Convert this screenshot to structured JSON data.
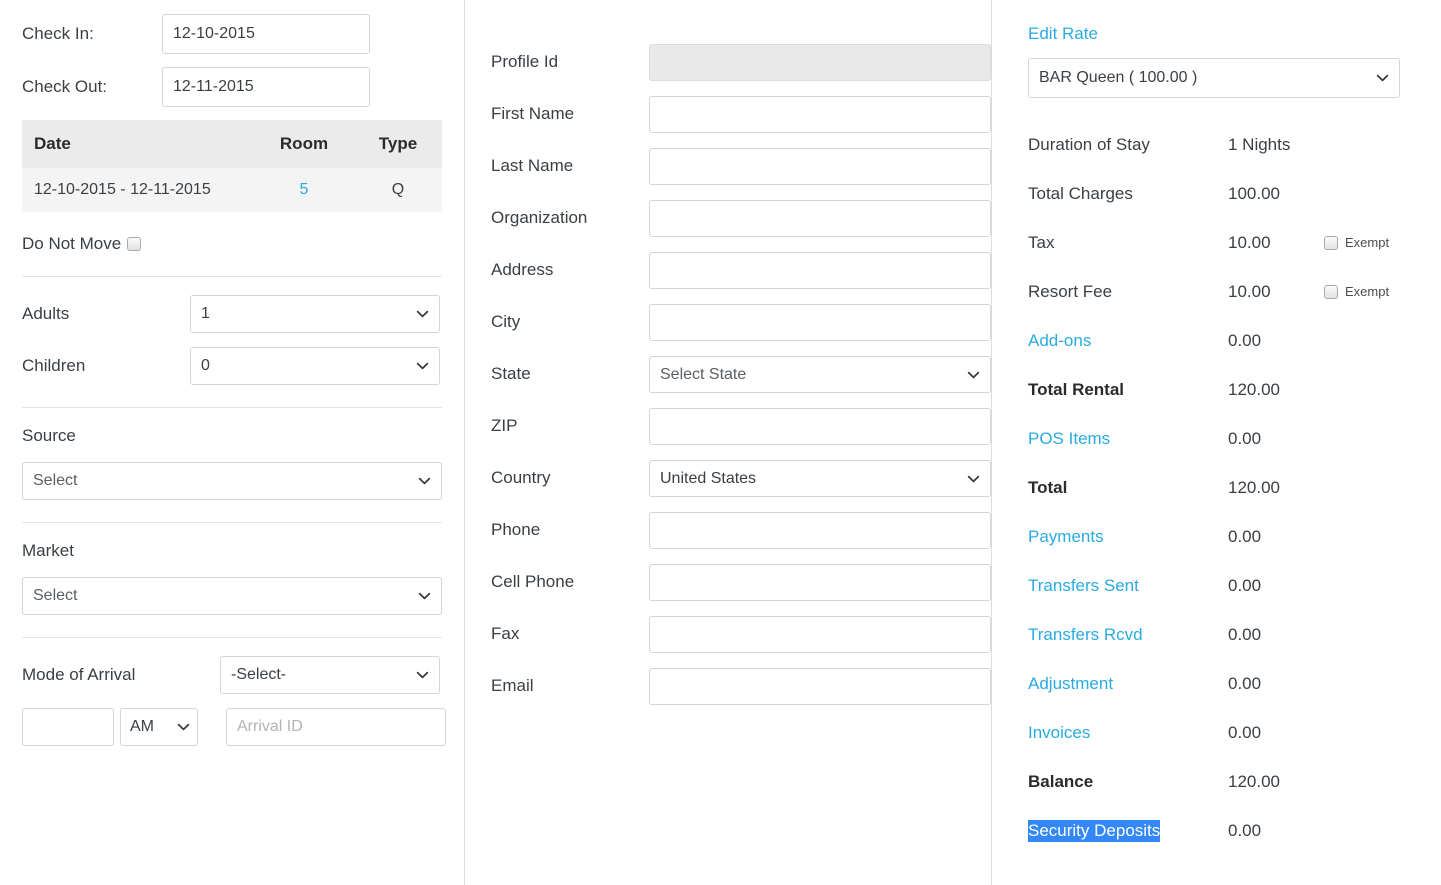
{
  "stay": {
    "check_in_label": "Check In:",
    "check_in_value": "12-10-2015",
    "check_out_label": "Check Out:",
    "check_out_value": "12-11-2015",
    "table": {
      "headers": [
        "Date",
        "Room",
        "Type"
      ],
      "rows": [
        {
          "date": "12-10-2015 - 12-11-2015",
          "room": "5",
          "type": "Q"
        }
      ]
    },
    "do_not_move_label": "Do Not Move",
    "occupancy": [
      {
        "label": "Adults",
        "value": "1"
      },
      {
        "label": "Children",
        "value": "0"
      }
    ],
    "source_label": "Source",
    "source_value": "Select",
    "market_label": "Market",
    "market_value": "Select",
    "mode_of_arrival_label": "Mode of Arrival",
    "mode_of_arrival_value": "-Select-",
    "arrival_time_value": "",
    "arrival_time_placeholder": "",
    "arrival_ampm_value": "AM",
    "arrival_id_placeholder": "Arrival ID",
    "arrival_id_value": ""
  },
  "profile": {
    "fields": [
      {
        "label": "Profile Id",
        "value": "",
        "type": "text-disabled"
      },
      {
        "label": "First Name",
        "value": "",
        "type": "text"
      },
      {
        "label": "Last Name",
        "value": "",
        "type": "text"
      },
      {
        "label": "Organization",
        "value": "",
        "type": "text"
      },
      {
        "label": "Address",
        "value": "",
        "type": "text"
      },
      {
        "label": "City",
        "value": "",
        "type": "text"
      },
      {
        "label": "State",
        "value": "Select State",
        "type": "select"
      },
      {
        "label": "ZIP",
        "value": "",
        "type": "text"
      },
      {
        "label": "Country",
        "value": "United States",
        "type": "select"
      },
      {
        "label": "Phone",
        "value": "",
        "type": "text"
      },
      {
        "label": "Cell Phone",
        "value": "",
        "type": "text"
      },
      {
        "label": "Fax",
        "value": "",
        "type": "text"
      },
      {
        "label": "Email",
        "value": "",
        "type": "text"
      }
    ]
  },
  "billing": {
    "edit_rate_label": "Edit Rate",
    "rate_value": "BAR Queen ( 100.00 )",
    "exempt_label": "Exempt",
    "rows": [
      {
        "label": "Duration of Stay",
        "value": "1 Nights",
        "style": "normal",
        "exempt": false
      },
      {
        "label": "Total Charges",
        "value": "100.00",
        "style": "normal",
        "exempt": false
      },
      {
        "label": "Tax",
        "value": "10.00",
        "style": "normal",
        "exempt": true
      },
      {
        "label": "Resort Fee",
        "value": "10.00",
        "style": "normal",
        "exempt": true
      },
      {
        "label": "Add-ons",
        "value": "0.00",
        "style": "link",
        "exempt": false
      },
      {
        "label": "Total Rental",
        "value": "120.00",
        "style": "bold",
        "exempt": false
      },
      {
        "label": "POS Items",
        "value": "0.00",
        "style": "link",
        "exempt": false
      },
      {
        "label": "Total",
        "value": "120.00",
        "style": "bold",
        "exempt": false
      },
      {
        "label": "Payments",
        "value": "0.00",
        "style": "link",
        "exempt": false
      },
      {
        "label": "Transfers Sent",
        "value": "0.00",
        "style": "link",
        "exempt": false
      },
      {
        "label": "Transfers Rcvd",
        "value": "0.00",
        "style": "link",
        "exempt": false
      },
      {
        "label": "Adjustment",
        "value": "0.00",
        "style": "link",
        "exempt": false
      },
      {
        "label": "Invoices",
        "value": "0.00",
        "style": "link",
        "exempt": false
      },
      {
        "label": "Balance",
        "value": "120.00",
        "style": "bold",
        "exempt": false
      },
      {
        "label": "Security Deposits",
        "value": "0.00",
        "style": "selected",
        "exempt": false
      }
    ]
  },
  "colors": {
    "link": "#29abe2",
    "selection": "#3388f5",
    "text": "#3a3f44",
    "table_header_bg": "#ebebeb",
    "table_row_bg": "#f4f4f4"
  }
}
